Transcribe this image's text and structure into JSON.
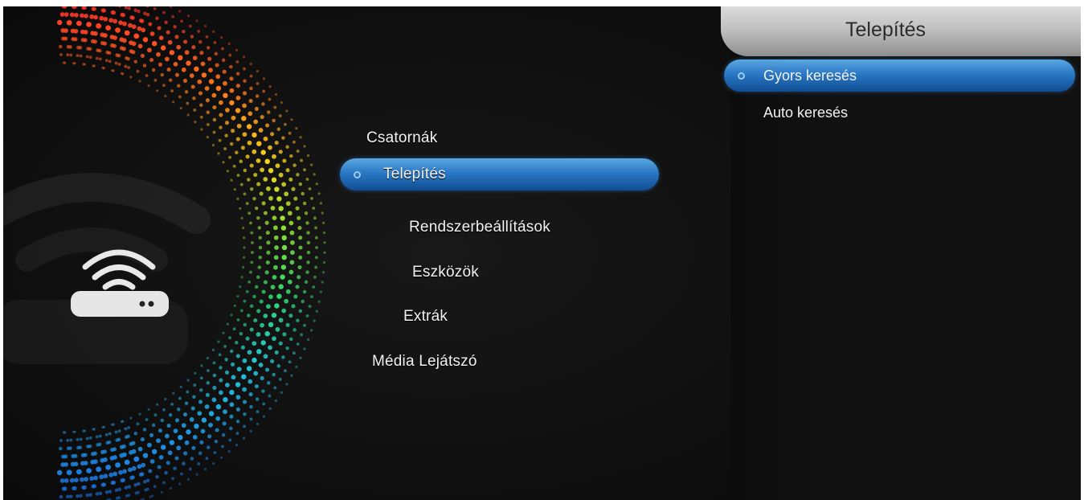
{
  "main_menu": {
    "items": [
      {
        "label": "Csatornák"
      },
      {
        "label": "Telepítés"
      },
      {
        "label": "Rendszerbeállítások"
      },
      {
        "label": "Eszközök"
      },
      {
        "label": "Extrák"
      },
      {
        "label": "Média Lejátszó"
      }
    ],
    "selected": "Telepítés"
  },
  "submenu": {
    "title": "Telepítés",
    "items": [
      {
        "label": "Gyors keresés"
      },
      {
        "label": "Auto keresés"
      }
    ],
    "selected": "Gyors keresés"
  },
  "icons": [
    "router-wifi-icon",
    "selection-bullet-icon"
  ],
  "colors": {
    "background": "#0c0c0c",
    "highlight": "#2a78c4",
    "header": "#bdbdbd",
    "text": "#f2f2f2",
    "header_text": "#2b2b2b"
  }
}
